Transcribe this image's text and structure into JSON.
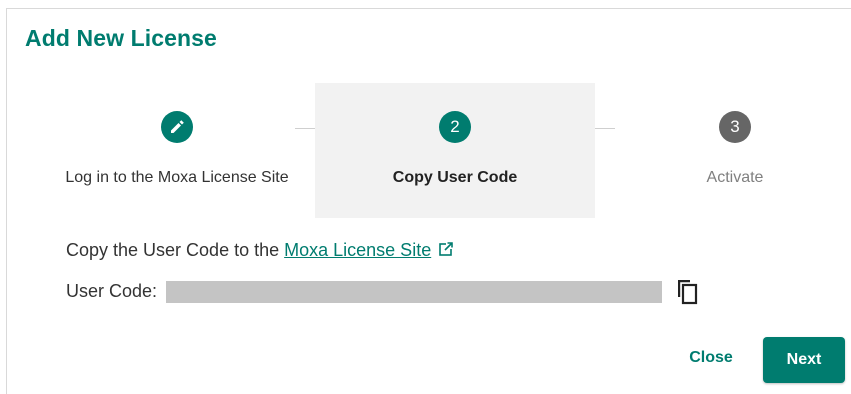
{
  "dialog": {
    "title": "Add New License"
  },
  "stepper": {
    "steps": [
      {
        "label": "Log in to the Moxa License Site",
        "status": "completed",
        "indicator": "pencil-icon"
      },
      {
        "label": "Copy User Code",
        "status": "current",
        "indicator": "2"
      },
      {
        "label": "Activate",
        "status": "pending",
        "indicator": "3"
      }
    ]
  },
  "content": {
    "instruction_prefix": "Copy the User Code to the ",
    "link_text": "Moxa License Site",
    "link_icon": "external-link-icon",
    "user_code_label": "User Code:",
    "user_code_value": "",
    "copy_icon": "copy-icon"
  },
  "actions": {
    "close_label": "Close",
    "next_label": "Next"
  },
  "colors": {
    "accent": "#007c6f",
    "pending_step": "#666666",
    "active_step_bg": "#f2f2f2",
    "masked_code": "#c4c4c4"
  }
}
